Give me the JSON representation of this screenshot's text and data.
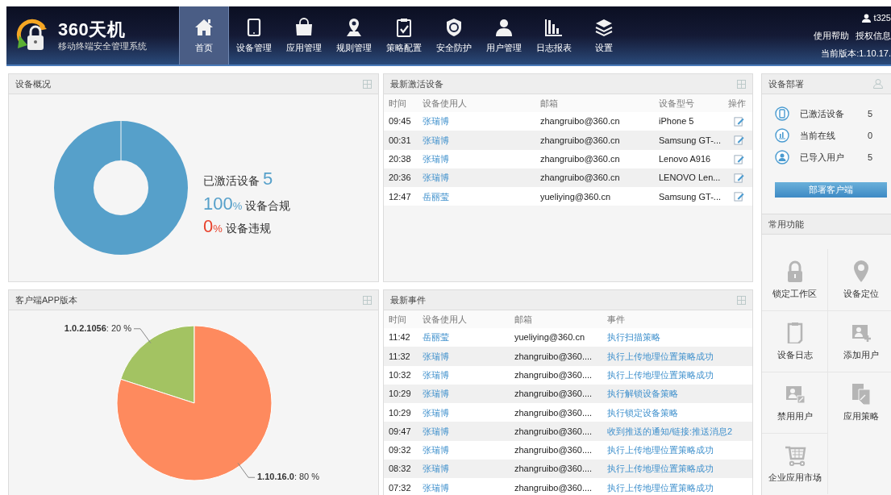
{
  "header": {
    "brand": "360天机",
    "subtitle": "移动终端安全管理系统",
    "nav": [
      {
        "label": "首页",
        "selected": true
      },
      {
        "label": "设备管理",
        "selected": false
      },
      {
        "label": "应用管理",
        "selected": false
      },
      {
        "label": "规则管理",
        "selected": false
      },
      {
        "label": "策略配置",
        "selected": false
      },
      {
        "label": "安全防护",
        "selected": false
      },
      {
        "label": "用户管理",
        "selected": false
      },
      {
        "label": "日志报表",
        "selected": false
      },
      {
        "label": "设置",
        "selected": false
      }
    ],
    "user": "t325",
    "links": [
      "使用帮助",
      "授权信息"
    ],
    "version": "当前版本:1.10.17."
  },
  "device_overview": {
    "title": "设备概况",
    "activated_label": "已激活设备",
    "activated_count": "5",
    "compliant_value": "100",
    "compliant_unit": "%",
    "compliant_label": "设备合规",
    "violation_value": "0",
    "violation_unit": "%",
    "violation_label": "设备违规"
  },
  "app_versions": {
    "title": "客户端APP版本",
    "chart_data": {
      "type": "pie",
      "values": [
        20,
        80
      ],
      "value_labels": [
        "**1.0.2.1056**: 20 %",
        "**1.10.16.0**: 80 %"
      ]
    }
  },
  "recent_devices": {
    "title": "最新激活设备",
    "columns": [
      "时间",
      "设备使用人",
      "邮箱",
      "设备型号",
      "操作"
    ],
    "rows": [
      {
        "time": "09:45",
        "user": "张瑞博",
        "email": "zhangruibo@360.cn",
        "model": "iPhone 5"
      },
      {
        "time": "00:31",
        "user": "张瑞博",
        "email": "zhangruibo@360.cn",
        "model": "Samsung GT-..."
      },
      {
        "time": "20:38",
        "user": "张瑞博",
        "email": "zhangruibo@360.cn",
        "model": "Lenovo A916"
      },
      {
        "time": "20:36",
        "user": "张瑞博",
        "email": "zhangruibo@360.cn",
        "model": "LENOVO Len..."
      },
      {
        "time": "12:47",
        "user": "岳丽莹",
        "email": "yueliying@360.cn",
        "model": "Samsung GT-..."
      }
    ]
  },
  "recent_events": {
    "title": "最新事件",
    "columns": [
      "时间",
      "设备使用人",
      "邮箱",
      "事件"
    ],
    "rows": [
      {
        "time": "11:42",
        "user": "岳丽莹",
        "email": "yueliying@360.cn",
        "event": "执行扫描策略"
      },
      {
        "time": "11:32",
        "user": "张瑞博",
        "email": "zhangruibo@360....",
        "event": "执行上传地理位置策略成功"
      },
      {
        "time": "10:32",
        "user": "张瑞博",
        "email": "zhangruibo@360....",
        "event": "执行上传地理位置策略成功"
      },
      {
        "time": "10:29",
        "user": "张瑞博",
        "email": "zhangruibo@360....",
        "event": "执行解锁设备策略"
      },
      {
        "time": "10:29",
        "user": "张瑞博",
        "email": "zhangruibo@360....",
        "event": "执行锁定设备策略"
      },
      {
        "time": "09:47",
        "user": "张瑞博",
        "email": "zhangruibo@360....",
        "event": "收到推送的通知/链接:推送消息2"
      },
      {
        "time": "09:32",
        "user": "张瑞博",
        "email": "zhangruibo@360....",
        "event": "执行上传地理位置策略成功"
      },
      {
        "time": "08:32",
        "user": "张瑞博",
        "email": "zhangruibo@360....",
        "event": "执行上传地理位置策略成功"
      },
      {
        "time": "07:32",
        "user": "张瑞博",
        "email": "zhangruibo@360....",
        "event": "执行上传地理位置策略成功"
      }
    ]
  },
  "deployment": {
    "title": "设备部署",
    "stats": [
      {
        "label": "已激活设备",
        "value": "5"
      },
      {
        "label": "当前在线",
        "value": "0"
      },
      {
        "label": "已导入用户",
        "value": "5"
      }
    ],
    "button": "部署客户端"
  },
  "common_functions": {
    "title": "常用功能",
    "items": [
      {
        "label": "锁定工作区"
      },
      {
        "label": "设备定位"
      },
      {
        "label": "设备日志"
      },
      {
        "label": "添加用户"
      },
      {
        "label": "禁用用户"
      },
      {
        "label": "应用策略"
      },
      {
        "label": "企业应用市场"
      }
    ]
  }
}
